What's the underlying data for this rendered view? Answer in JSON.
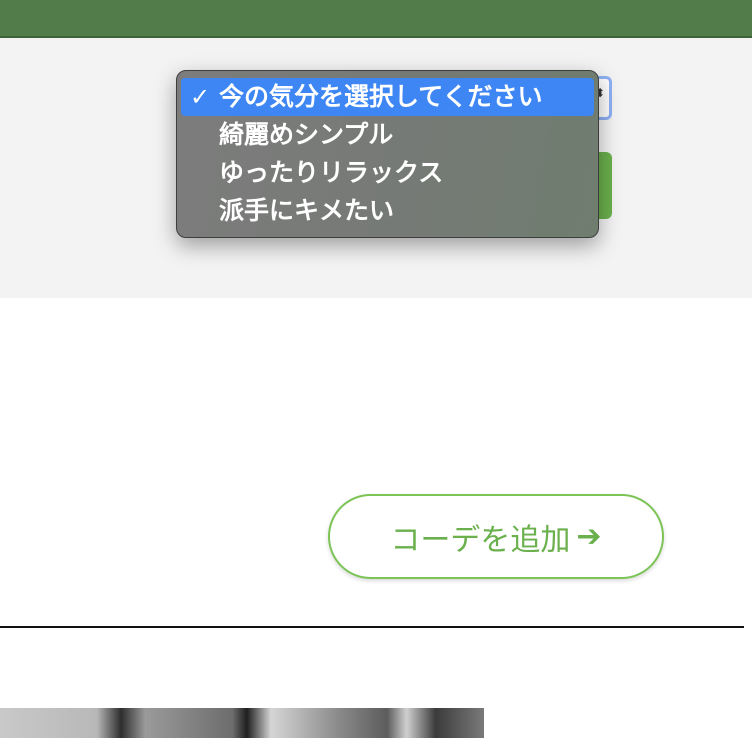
{
  "mood_select": {
    "options": [
      {
        "label": "今の気分を選択してください",
        "selected": true
      },
      {
        "label": "綺麗めシンプル",
        "selected": false
      },
      {
        "label": "ゆったりリラックス",
        "selected": false
      },
      {
        "label": "派手にキメたい",
        "selected": false
      }
    ],
    "check_mark": "✓",
    "arrow_glyph": "⬍"
  },
  "add_outfit": {
    "label": "コーデを追加",
    "arrow_glyph": "➔"
  },
  "colors": {
    "header": "#527d4b",
    "selected_option": "#3d86f4",
    "accent_green": "#6ab04c"
  }
}
